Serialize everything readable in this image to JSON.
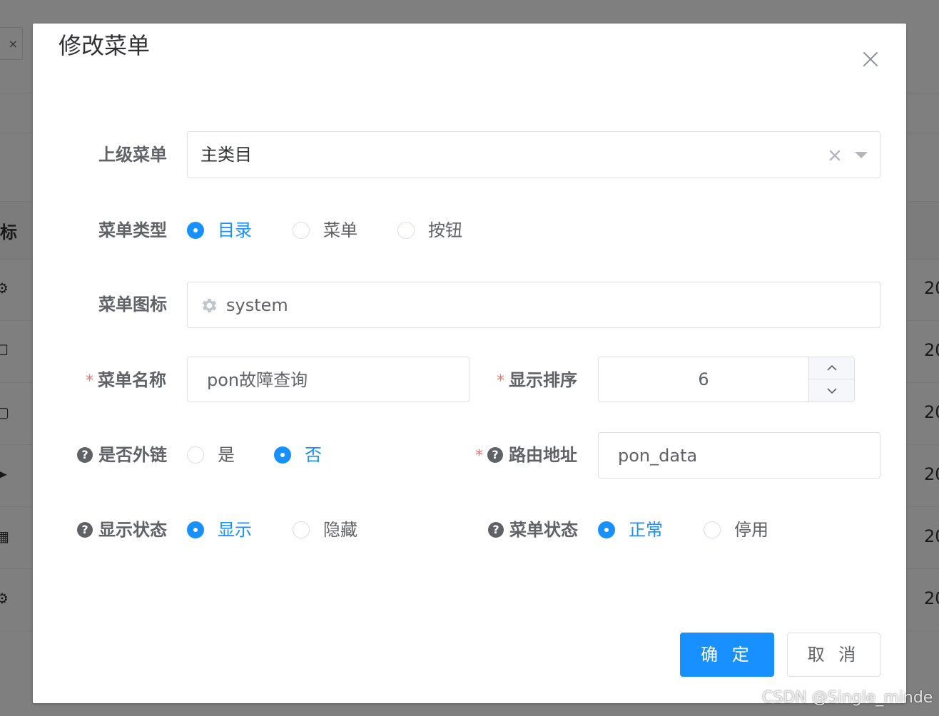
{
  "background": {
    "tab_close": "×",
    "table_header_fragment": "标",
    "row_date_fragment": "20"
  },
  "dialog": {
    "title": "修改菜单",
    "close_icon": "close-icon"
  },
  "form": {
    "parent_menu": {
      "label": "上级菜单",
      "value": "主类目"
    },
    "menu_type": {
      "label": "菜单类型",
      "options": [
        "目录",
        "菜单",
        "按钮"
      ],
      "selected": "目录"
    },
    "menu_icon": {
      "label": "菜单图标",
      "value": "system",
      "icon": "gear-icon"
    },
    "menu_name": {
      "required": "*",
      "label": "菜单名称",
      "value": "pon故障查询"
    },
    "display_order": {
      "required": "*",
      "label": "显示排序",
      "value": "6"
    },
    "external_link": {
      "label": "是否外链",
      "options": [
        "是",
        "否"
      ],
      "selected": "否"
    },
    "route_path": {
      "required": "*",
      "label": "路由地址",
      "value": "pon_data"
    },
    "visible": {
      "label": "显示状态",
      "options": [
        "显示",
        "隐藏"
      ],
      "selected": "显示"
    },
    "status": {
      "label": "菜单状态",
      "options": [
        "正常",
        "停用"
      ],
      "selected": "正常"
    }
  },
  "footer": {
    "confirm_label": "确 定",
    "cancel_label": "取 消"
  },
  "watermark": "CSDN @Single_minde",
  "colors": {
    "primary": "#1890ff",
    "required": "#f56c6c",
    "label": "#606266"
  }
}
